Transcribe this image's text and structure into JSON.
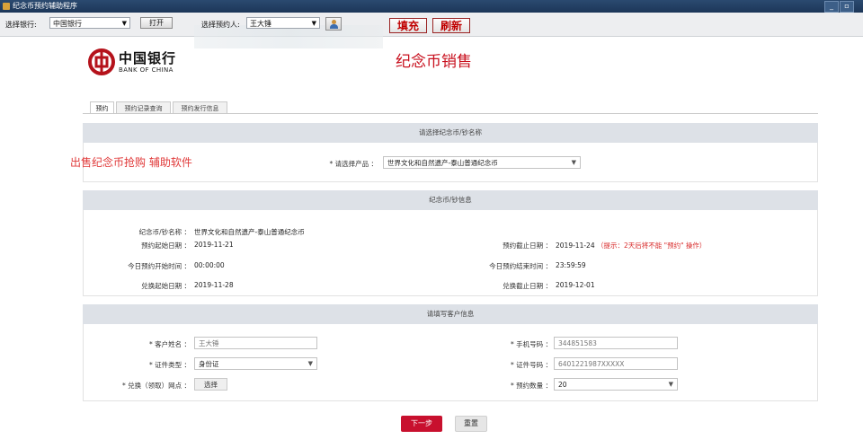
{
  "window": {
    "title": "纪念币预约辅助程序",
    "minimize": "_",
    "restore": "▫"
  },
  "toolbar": {
    "bank_label": "选择银行:",
    "bank_value": "中国银行",
    "open_button": "打开",
    "person_label": "选择预约人:",
    "person_value": "王大锤",
    "fill_button": "填充",
    "refresh_button": "刷新"
  },
  "header": {
    "bank_name_cn": "中国银行",
    "bank_name_en": "BANK OF CHINA",
    "page_title": "纪念币销售",
    "brand_color": "#c8101e"
  },
  "tabs": [
    {
      "label": "预约",
      "active": true
    },
    {
      "label": "预约记录查询",
      "active": false
    },
    {
      "label": "预约发行信息",
      "active": false
    }
  ],
  "promo_text": "出售纪念币抢购 辅助软件",
  "section_select": {
    "heading": "请选择纪念币/钞名称",
    "product_label": "请选择产品 ：",
    "product_value": "世界文化和自然遗产-泰山普通纪念币"
  },
  "section_info": {
    "heading": "纪念币/钞信息",
    "name_label": "纪念币/钞名称 ：",
    "name_value": "世界文化和自然遗产-泰山普通纪念币",
    "start_label": "预约起始日期 ：",
    "start_value": "2019-11-21",
    "end_label": "预约截止日期 ：",
    "end_value": "2019-11-24",
    "end_note": "（提示：2天后将不能 \"预约\" 操作）",
    "today_start_label": "今日预约开始时间 ：",
    "today_start_value": "00:00:00",
    "today_end_label": "今日预约结束时间 ：",
    "today_end_value": "23:59:59",
    "exchange_start_label": "兑换起始日期 ：",
    "exchange_start_value": "2019-11-28",
    "exchange_end_label": "兑换截止日期 ：",
    "exchange_end_value": "2019-12-01"
  },
  "section_customer": {
    "heading": "请填写客户信息",
    "name_label": "客户姓名 ：",
    "name_value": "王大锤",
    "phone_label": "手机号码 ：",
    "phone_value": "344851583",
    "idtype_label": "证件类型 ：",
    "idtype_value": "身份证",
    "idnum_label": "证件号码 ：",
    "idnum_value": "6401221987XXXXX",
    "branch_label": "兑换（领取）网点 ：",
    "branch_button": "选择",
    "qty_label": "预约数量 ：",
    "qty_value": "20"
  },
  "actions": {
    "next": "下一步",
    "reset": "重置"
  },
  "icons": [
    "app-icon",
    "person-icon",
    "dropdown-arrow-icon",
    "boc-logo-icon"
  ]
}
